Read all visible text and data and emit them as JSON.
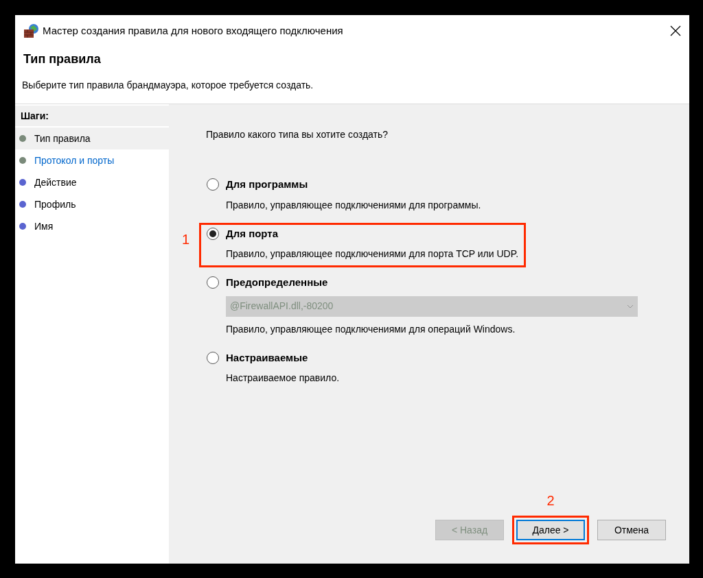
{
  "window": {
    "title": "Мастер создания правила для нового входящего подключения"
  },
  "header": {
    "title": "Тип правила",
    "description": "Выберите тип правила брандмауэра, которое требуется создать."
  },
  "steps": {
    "title": "Шаги:",
    "items": [
      {
        "label": "Тип правила",
        "selected": true,
        "hovered": false,
        "color": "#7a8a7a"
      },
      {
        "label": "Протокол и порты",
        "selected": false,
        "hovered": true,
        "color": "#7a8a7a"
      },
      {
        "label": "Действие",
        "selected": false,
        "hovered": false,
        "color": "#5a64d0"
      },
      {
        "label": "Профиль",
        "selected": false,
        "hovered": false,
        "color": "#5a64d0"
      },
      {
        "label": "Имя",
        "selected": false,
        "hovered": false,
        "color": "#5a64d0"
      }
    ]
  },
  "question": "Правило какого типа вы хотите создать?",
  "options": [
    {
      "label": "Для программы",
      "description": "Правило, управляющее подключениями для программы.",
      "selected": false,
      "highlighted": false
    },
    {
      "label": "Для порта",
      "description": "Правило, управляющее подключениями для порта TCP или UDP.",
      "selected": true,
      "highlighted": true,
      "annotation": "1"
    },
    {
      "label": "Предопределенные",
      "description": "Правило, управляющее подключениями для операций Windows.",
      "selected": false,
      "highlighted": false,
      "dropdown": {
        "value": "@FirewallAPI.dll,-80200",
        "disabled": true
      }
    },
    {
      "label": "Настраиваемые",
      "description": "Настраиваемое правило.",
      "selected": false,
      "highlighted": false
    }
  ],
  "buttons": [
    {
      "label": "< Назад",
      "disabled": true,
      "focused": false,
      "highlighted": false
    },
    {
      "label": "Далее >",
      "disabled": false,
      "focused": true,
      "highlighted": true,
      "annotation": "2"
    },
    {
      "label": "Отмена",
      "disabled": false,
      "focused": false,
      "highlighted": false
    }
  ]
}
